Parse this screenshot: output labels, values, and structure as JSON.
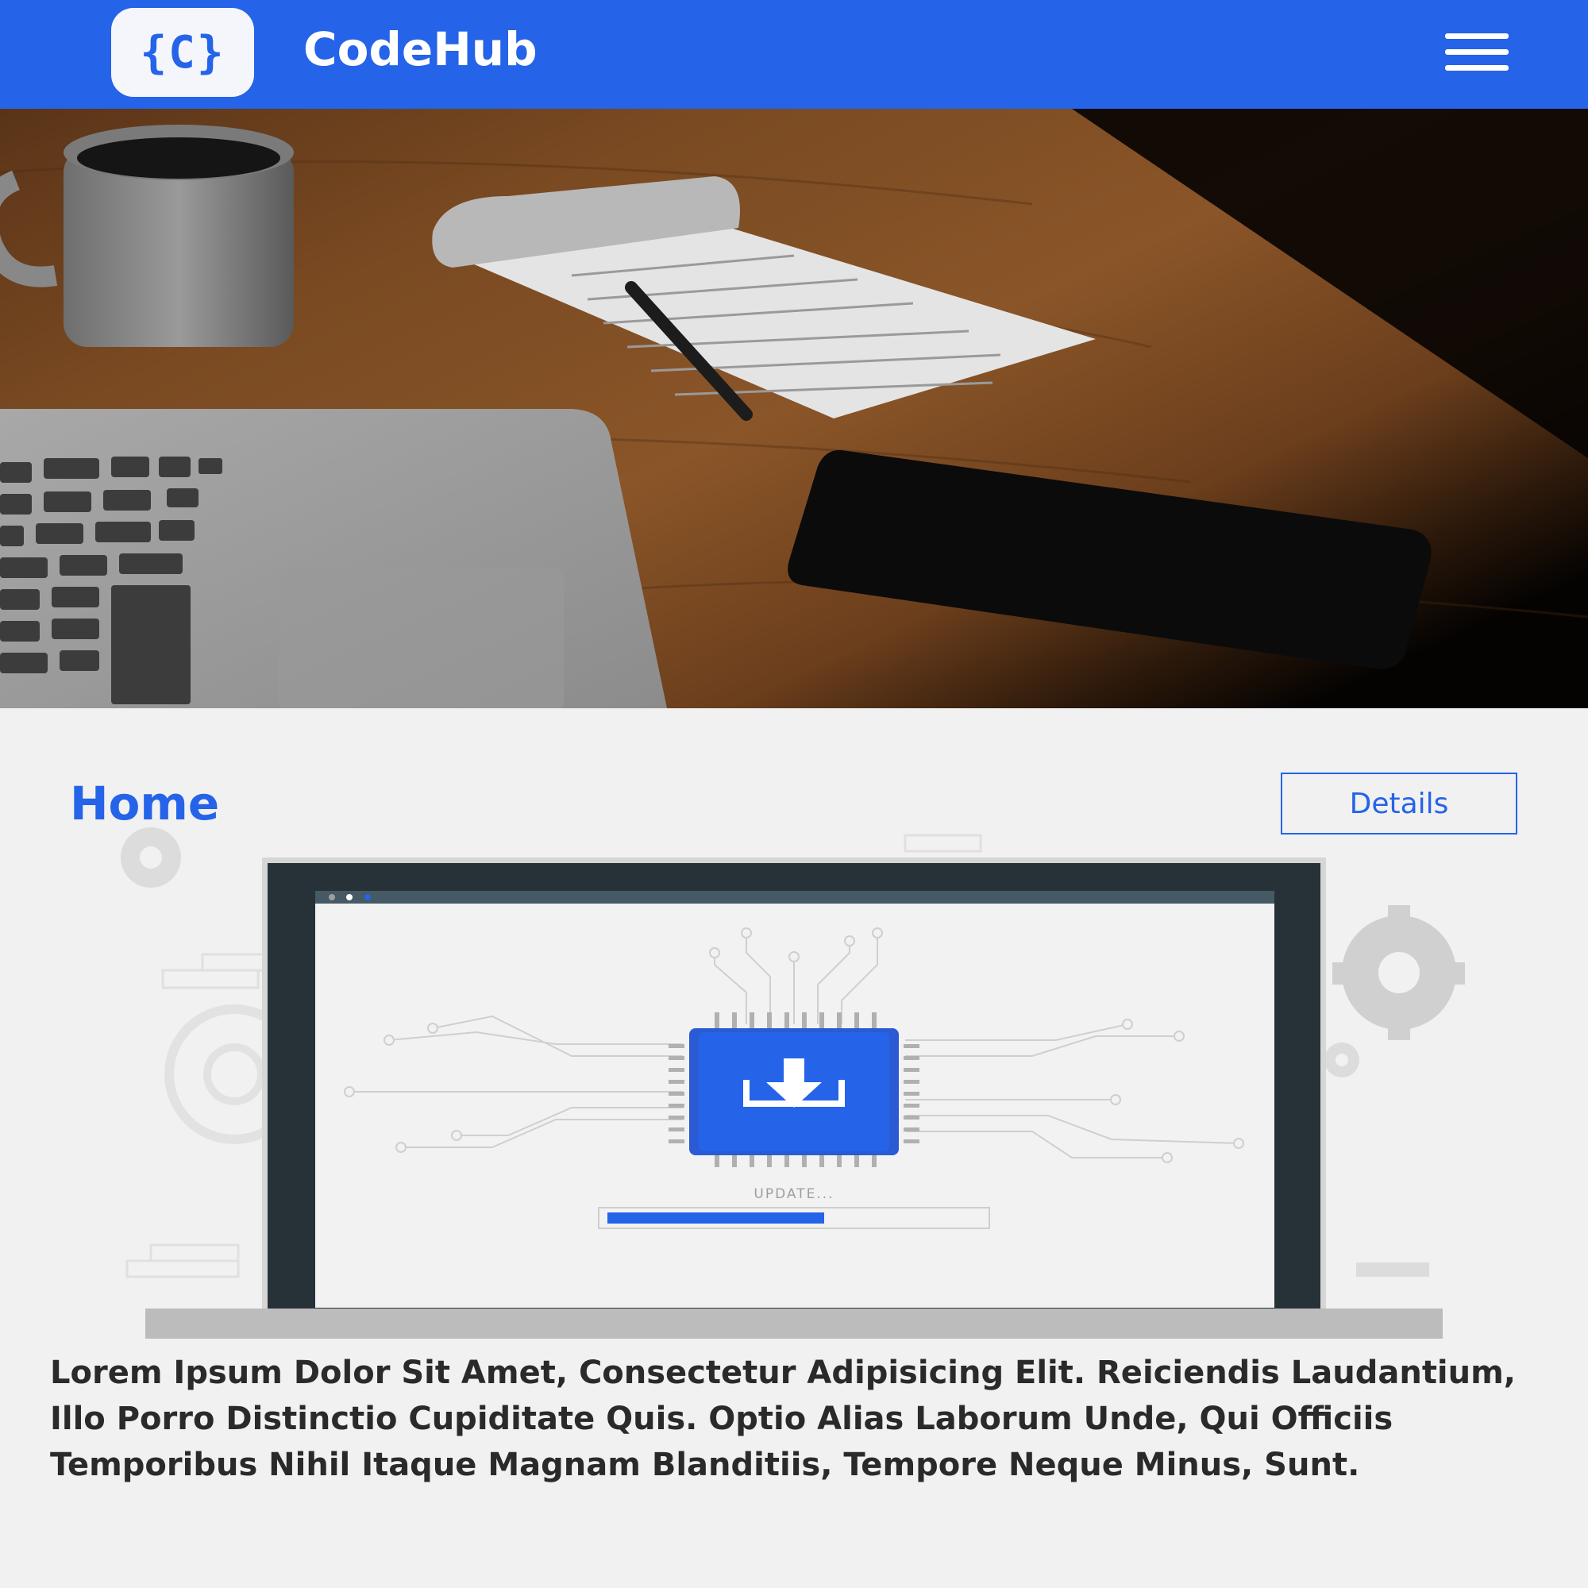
{
  "header": {
    "logo_text": "{C}",
    "brand": "CodeHub",
    "menu_icon": "hamburger-menu-icon",
    "accent_color": "#2563e8"
  },
  "hero": {
    "description_icons": [
      "coffee-mug",
      "notepad",
      "pen",
      "laptop",
      "smartphone"
    ]
  },
  "section": {
    "title": "Home",
    "details_label": "Details",
    "illustration": {
      "icon": "download-chip-icon",
      "status_text": "UPDATE...",
      "progress": 0.58
    },
    "body": "Lorem Ipsum Dolor Sit Amet, Consectetur Adipisicing Elit. Reiciendis Laudantium, Illo Porro Distinctio Cupiditate Quis. Optio Alias Laborum Unde, Qui Officiis Temporibus Nihil Itaque Magnam Blanditiis, Tempore Neque Minus, Sunt."
  }
}
